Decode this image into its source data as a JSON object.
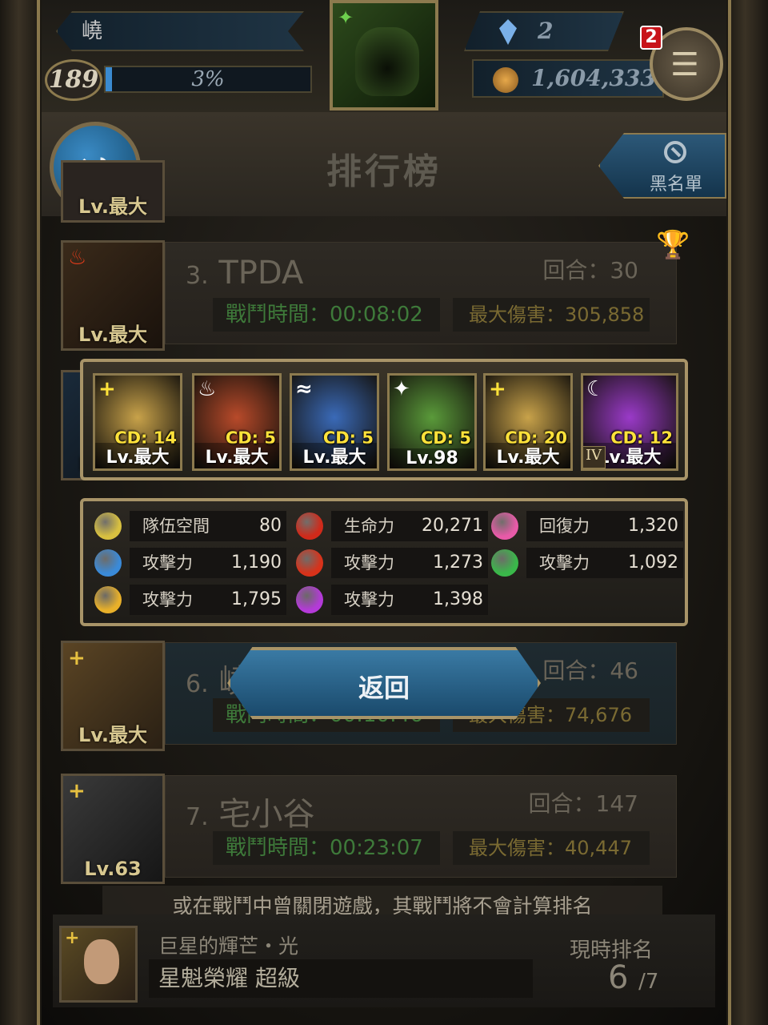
{
  "hud": {
    "player_name": "嶢",
    "player_level": "189",
    "exp_percent": "3%",
    "exp_fill": 0.03,
    "gems": "2",
    "coins": "1,604,333",
    "notification_count": "2"
  },
  "header": {
    "title": "排行榜",
    "blacklist_label": "黑名單"
  },
  "rankings": [
    {
      "rank": "3.",
      "name": "TPDA",
      "round_label": "回合：30",
      "battle_time_label": "戰鬥時間：",
      "battle_time": "00:08:02",
      "max_damage_label": "最大傷害：",
      "max_damage": "305,858",
      "leader_level": "Lv.最大"
    },
    {
      "rank": "6.",
      "name": "嶢",
      "round_label": "回合：46",
      "battle_time_label": "戰鬥時間：",
      "battle_time": "00:10:46",
      "max_damage_label": "最大傷害：",
      "max_damage": "74,676",
      "leader_level": "Lv.最大"
    },
    {
      "rank": "7.",
      "name": "宅小谷",
      "round_label": "回合：147",
      "battle_time_label": "戰鬥時間：",
      "battle_time": "00:23:07",
      "max_damage_label": "最大傷害：",
      "max_damage": "40,447",
      "leader_level": "Lv.63"
    }
  ],
  "partial_levels": [
    "Lv.最大",
    "Lv.最大"
  ],
  "team": [
    {
      "element": "light",
      "symbol": "+",
      "cd": "CD: 14",
      "level": "Lv.最大",
      "color": "#c8a24a"
    },
    {
      "element": "fire",
      "symbol": "♨",
      "cd": "CD: 5",
      "level": "Lv.最大",
      "color": "#b84a2a"
    },
    {
      "element": "water",
      "symbol": "≈",
      "cd": "CD: 5",
      "level": "Lv.最大",
      "color": "#3a6ab8"
    },
    {
      "element": "wood",
      "symbol": "✦",
      "cd": "CD: 5",
      "level": "Lv.98",
      "color": "#5a9a3a"
    },
    {
      "element": "light",
      "symbol": "+",
      "cd": "CD: 20",
      "level": "Lv.最大",
      "color": "#c8a24a"
    },
    {
      "element": "dark",
      "symbol": "☾",
      "cd": "CD: 12",
      "level": "Lv.最大",
      "color": "#9a3ac8",
      "badge": "IV"
    }
  ],
  "stats": [
    {
      "label": "隊伍空間",
      "value": "80",
      "icon": "flag-icon",
      "color": "#d8c040"
    },
    {
      "label": "生命力",
      "value": "20,271",
      "icon": "hp-drop-icon",
      "color": "#d02a1a"
    },
    {
      "label": "回復力",
      "value": "1,320",
      "icon": "heart-icon",
      "color": "#e85aa8"
    },
    {
      "label": "攻擊力",
      "value": "1,190",
      "icon": "water-orb-icon",
      "color": "#3a8ad8"
    },
    {
      "label": "攻擊力",
      "value": "1,273",
      "icon": "fire-orb-icon",
      "color": "#d8321a"
    },
    {
      "label": "攻擊力",
      "value": "1,092",
      "icon": "wood-orb-icon",
      "color": "#3ab84a"
    },
    {
      "label": "攻擊力",
      "value": "1,795",
      "icon": "light-orb-icon",
      "color": "#e8b02a"
    },
    {
      "label": "攻擊力",
      "value": "1,398",
      "icon": "dark-orb-icon",
      "color": "#b43ad8"
    }
  ],
  "return_label": "返回",
  "footer": {
    "notice": "或在戰鬥中曾關閉遊戲，其戰鬥將不會計算排名",
    "my_title": "巨星的輝芒・光",
    "my_rank_title": "星魁榮耀 超級",
    "current_rank_label": "現時排名",
    "current_rank": "6",
    "total": "/7"
  },
  "colors": {
    "accent_gold": "#a89468",
    "time_green": "#3e7a3a",
    "damage_gold": "#7a6a32",
    "cd_yellow": "#ffe23a"
  }
}
